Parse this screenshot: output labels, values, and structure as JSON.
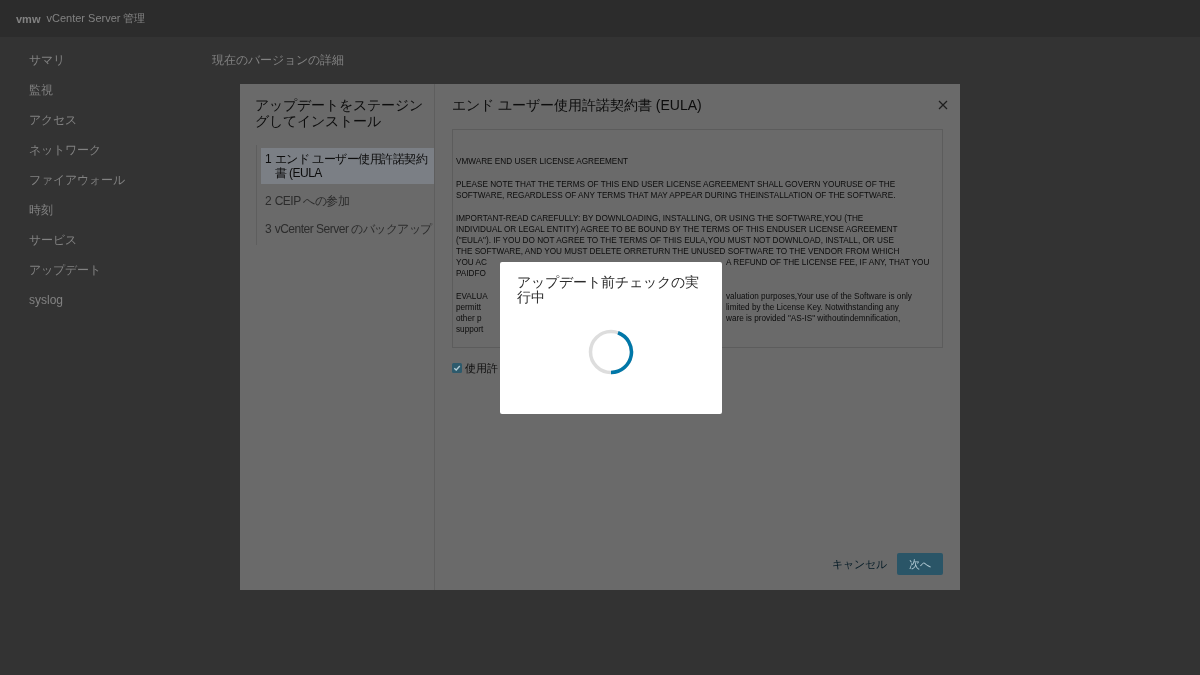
{
  "header": {
    "logo": "vmw",
    "title": "vCenter Server 管理"
  },
  "sidebar": {
    "items": [
      {
        "label": "サマリ"
      },
      {
        "label": "監視"
      },
      {
        "label": "アクセス"
      },
      {
        "label": "ネットワーク"
      },
      {
        "label": "ファイアウォール"
      },
      {
        "label": "時刻"
      },
      {
        "label": "サービス"
      },
      {
        "label": "アップデート"
      },
      {
        "label": "syslog"
      }
    ]
  },
  "main": {
    "heading": "現在のバージョンの詳細"
  },
  "wizard": {
    "title": "アップデートをステージングしてインストール",
    "steps": [
      {
        "number": "1",
        "label": "エンド ユーザー使用許諾契約書 (EULA",
        "selected": true,
        "disabled": false
      },
      {
        "number": "2",
        "label": "CEIP への参加",
        "selected": false,
        "disabled": true
      },
      {
        "number": "3",
        "label": "vCenter Server のバックアップ",
        "selected": false,
        "disabled": true
      }
    ],
    "page_title": "エンド ユーザー使用許諾契約書 (EULA)",
    "eula": {
      "paragraphs": [
        {
          "lines": [
            "VMWARE END USER LICENSE AGREEMENT"
          ]
        },
        {
          "lines": [
            "PLEASE NOTE THAT THE TERMS OF THIS END USER LICENSE AGREEMENT SHALL GOVERN YOURUSE OF THE",
            "SOFTWARE, REGARDLESS OF ANY TERMS THAT MAY APPEAR DURING THEINSTALLATION OF THE SOFTWARE."
          ]
        },
        {
          "lines": [
            "IMPORTANT-READ CAREFULLY: BY DOWNLOADING, INSTALLING, OR USING THE SOFTWARE,YOU (THE",
            "INDIVIDUAL OR LEGAL ENTITY) AGREE TO BE BOUND BY THE TERMS OF THIS ENDUSER LICENSE AGREEMENT",
            "(\"EULA\"). IF YOU DO NOT AGREE TO THE TERMS OF THIS EULA,YOU MUST NOT DOWNLOAD, INSTALL, OR USE",
            "THE SOFTWARE, AND YOU MUST DELETE ORRETURN THE UNUSED SOFTWARE TO THE VENDOR FROM WHICH"
          ],
          "fragments": [
            {
              "left": "YOU AC",
              "right": "A REFUND OF THE LICENSE FEE, IF ANY, THAT YOU"
            },
            {
              "left": "PAIDFO"
            }
          ]
        },
        {
          "fragments": [
            {
              "left": "EVALUA",
              "right": "valuation purposes,Your use of the Software is only"
            },
            {
              "left": "permitt",
              "right": "limited by the License Key. Notwithstanding any"
            },
            {
              "left": "other p",
              "right": "ware is provided \"AS-IS\" withoutindemnification,"
            },
            {
              "left": "support"
            }
          ]
        }
      ]
    },
    "accept_checkbox": {
      "label": "使用許",
      "checked": true
    },
    "buttons": [
      {
        "label": "キャンセル",
        "kind": "flat"
      },
      {
        "label": "次へ",
        "kind": "primary"
      }
    ]
  },
  "progress_dialog": {
    "title": "アップデート前チェックの実行中"
  }
}
